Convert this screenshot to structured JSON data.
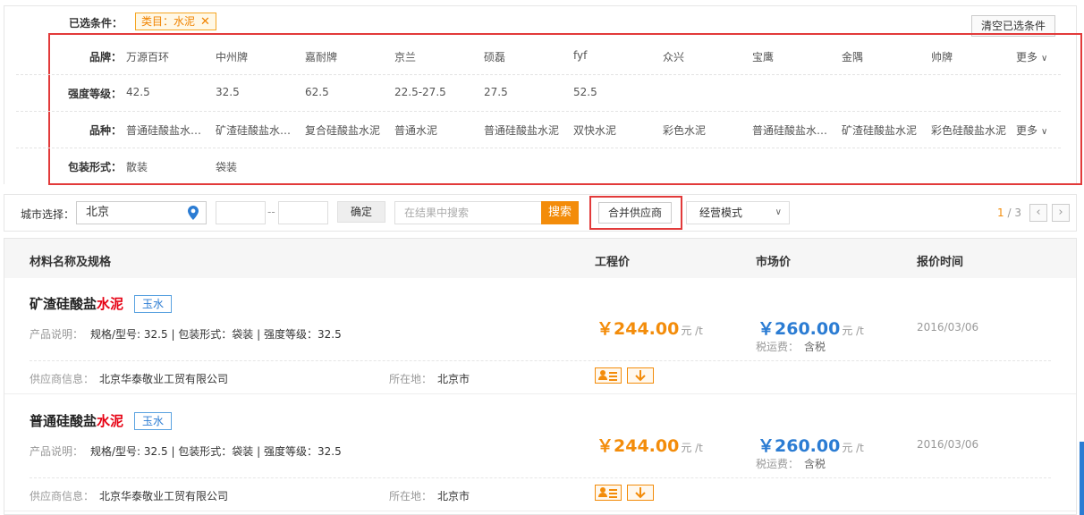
{
  "selected": {
    "label": "已选条件：",
    "tag": "类目：水泥",
    "clear": "清空已选条件"
  },
  "filters": {
    "brand": {
      "label": "品牌：",
      "options": [
        "万源百环",
        "中州牌",
        "嘉耐牌",
        "京兰",
        "硕磊",
        "fyf",
        "众兴",
        "宝鹰",
        "金隅",
        "帅牌"
      ],
      "more": "更多"
    },
    "grade": {
      "label": "强度等级：",
      "options": [
        "42.5",
        "32.5",
        "62.5",
        "22.5-27.5",
        "27.5",
        "52.5"
      ]
    },
    "variety": {
      "label": "品种：",
      "options": [
        "普通硅酸盐水…",
        "矿渣硅酸盐水…",
        "复合硅酸盐水泥",
        "普通水泥",
        "普通硅酸盐水泥",
        "双快水泥",
        "彩色水泥",
        "普通硅酸盐水…",
        "矿渣硅酸盐水泥",
        "彩色硅酸盐水泥"
      ],
      "more": "更多"
    },
    "package": {
      "label": "包装形式：",
      "options": [
        "散装",
        "袋装"
      ]
    }
  },
  "toolbar": {
    "city_label": "城市选择：",
    "city_value": "北京",
    "range_sep": "--",
    "ok": "确定",
    "search_placeholder": "在结果中搜索",
    "search": "搜索",
    "merge": "合并供应商",
    "mode": "经营模式",
    "page_current": "1",
    "page_total": "/ 3"
  },
  "table": {
    "headers": {
      "name": "材料名称及规格",
      "eng_price": "工程价",
      "market_price": "市场价",
      "time": "报价时间"
    },
    "items": [
      {
        "title_prefix": "矿渣硅酸盐",
        "title_hl": "水泥",
        "brand": "玉水",
        "desc_key": "产品说明：",
        "desc": "规格/型号: 32.5 | 包装形式：袋装 | 强度等级：32.5",
        "supplier_key": "供应商信息：",
        "supplier": "北京华泰敬业工贸有限公司",
        "loc_key": "所在地：",
        "loc": "北京市",
        "eng_price": "￥244.00",
        "eng_unit": "元 /t",
        "mkt_price": "￥260.00",
        "mkt_unit": "元 /t",
        "tax_key": "税运费：",
        "tax": "含税",
        "date": "2016/03/06"
      },
      {
        "title_prefix": "普通硅酸盐",
        "title_hl": "水泥",
        "brand": "玉水",
        "desc_key": "产品说明：",
        "desc": "规格/型号: 32.5 | 包装形式：袋装 | 强度等级：32.5",
        "supplier_key": "供应商信息：",
        "supplier": "北京华泰敬业工贸有限公司",
        "loc_key": "所在地：",
        "loc": "北京市",
        "eng_price": "￥244.00",
        "eng_unit": "元 /t",
        "mkt_price": "￥260.00",
        "mkt_unit": "元 /t",
        "tax_key": "税运费：",
        "tax": "含税",
        "date": "2016/03/06"
      }
    ]
  },
  "colors": {
    "accent_orange": "#f38c0a",
    "price_blue": "#2b7cd3",
    "highlight_red": "#e23a3a"
  }
}
